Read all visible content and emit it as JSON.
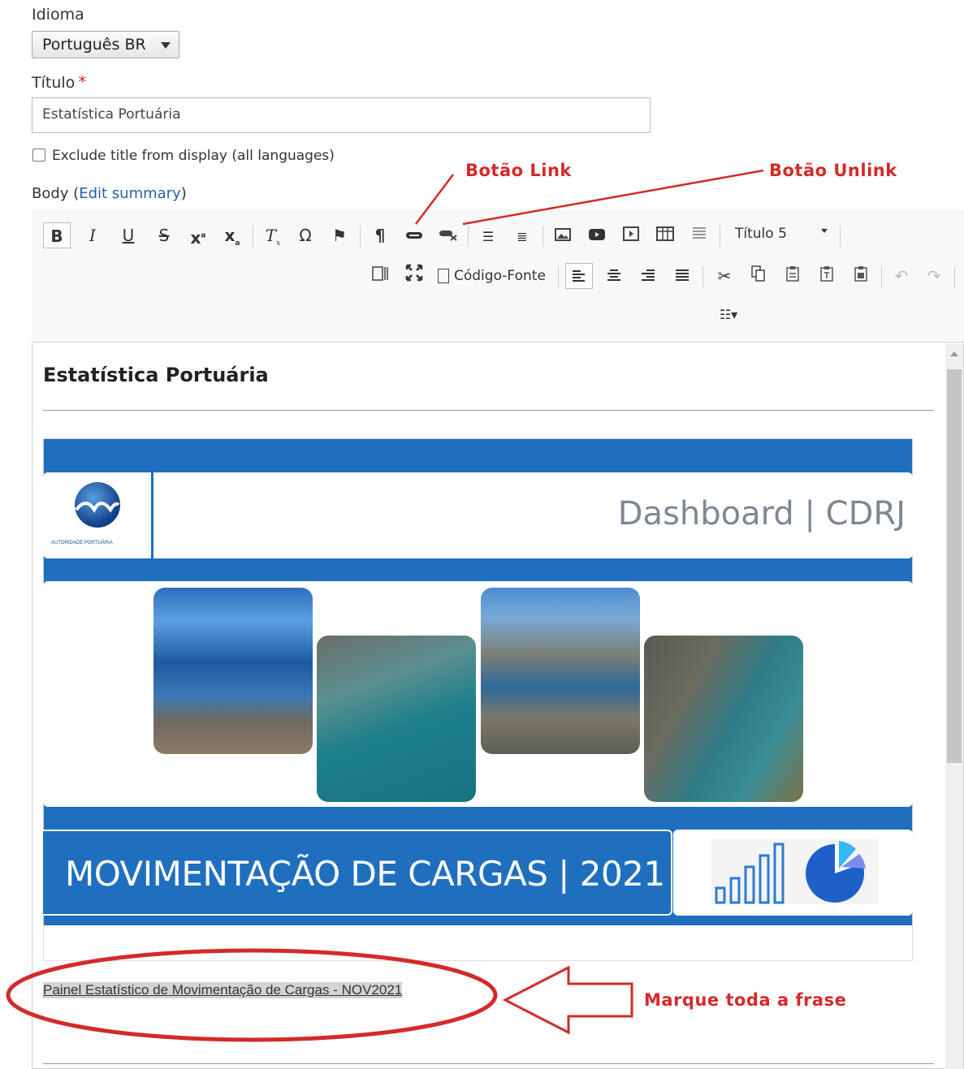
{
  "form": {
    "language_label": "Idioma",
    "language_value": "Português BR",
    "title_label": "Título",
    "required_mark": "*",
    "title_value": "Estatística Portuária",
    "exclude_label": "Exclude title from display (all languages)",
    "body_label": "Body",
    "edit_summary_link": "Edit summary"
  },
  "annotations": {
    "link_button": "Botão Link",
    "unlink_button": "Botão Unlink",
    "select_phrase": "Marque toda a frase",
    "color": "#d42a2a"
  },
  "toolbar": {
    "row1": [
      "bold",
      "italic",
      "underline",
      "strikethrough",
      "superscript",
      "subscript",
      "remove-format",
      "special-char",
      "anchor",
      "paragraph",
      "link",
      "unlink",
      "bulleted-list",
      "numbered-list",
      "image",
      "video",
      "media",
      "table",
      "horizontal-line",
      "format",
      "format-dropdown"
    ],
    "bold_label": "B",
    "italic_label": "I",
    "underline_label": "U",
    "strike_label": "S",
    "format_value": "Título 5",
    "source_label": "Código-Fonte",
    "row2": [
      "show-blocks",
      "maximize",
      "source",
      "align-left",
      "align-center",
      "align-right",
      "justify",
      "cut",
      "copy",
      "paste",
      "paste-text",
      "paste-word",
      "undo",
      "redo"
    ],
    "row3": [
      "line-height"
    ]
  },
  "content": {
    "heading": "Estatística Portuária",
    "banner_title": "Dashboard | CDRJ",
    "logo_caption": "AUTORIDADE PORTUÁRIA",
    "banner_caption": "MOVIMENTAÇÃO DE CARGAS | 2021",
    "link_phrase": "Painel Estatístico de Movimentação de Cargas - NOV2021"
  },
  "colors": {
    "banner_blue": "#1f6fbe",
    "link_blue": "#2a5db0",
    "required_red": "#e03030"
  }
}
